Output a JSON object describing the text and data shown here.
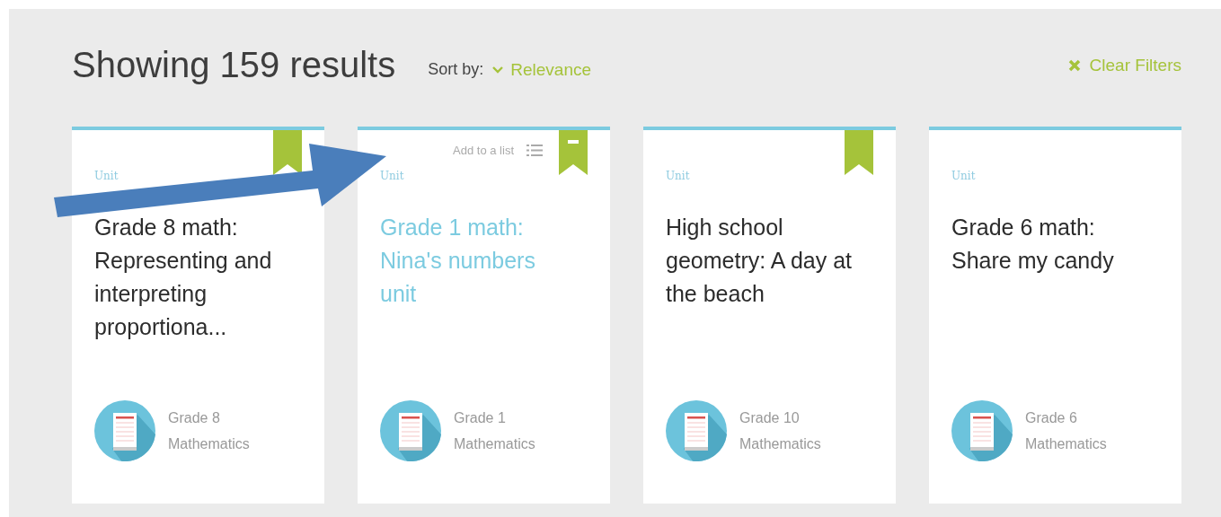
{
  "header": {
    "title": "Showing 159 results",
    "sort_label": "Sort by:",
    "sort_value": "Relevance",
    "clear_filters": "Clear Filters"
  },
  "cards": [
    {
      "type": "Unit",
      "title": "Grade 8 math: Representing and interpreting proportiona...",
      "highlighted": false,
      "bookmarked": true,
      "minus": false,
      "grade": "Grade 8",
      "subject": "Mathematics"
    },
    {
      "type": "Unit",
      "title": "Grade 1 math: Nina's numbers unit",
      "highlighted": true,
      "add_to_list": "Add to a list",
      "bookmarked": true,
      "minus": true,
      "grade": "Grade 1",
      "subject": "Mathematics"
    },
    {
      "type": "Unit",
      "title": "High school geometry: A day at the beach",
      "highlighted": false,
      "bookmarked": true,
      "minus": false,
      "grade": "Grade 10",
      "subject": "Mathematics"
    },
    {
      "type": "Unit",
      "title": "Grade 6 math: Share my candy",
      "highlighted": false,
      "bookmarked": false,
      "grade": "Grade 6",
      "subject": "Mathematics"
    }
  ]
}
